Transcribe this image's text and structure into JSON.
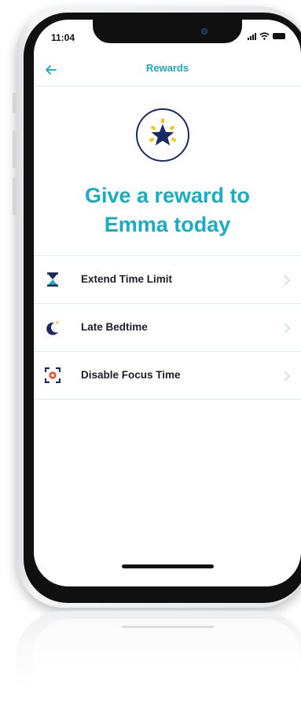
{
  "status_bar": {
    "time": "11:04"
  },
  "nav": {
    "back_icon": "arrow-left-icon",
    "title": "Rewards"
  },
  "hero": {
    "icon": "star-badge-icon",
    "headline_line1": "Give a reward to",
    "headline_line2": "Emma today"
  },
  "rewards": [
    {
      "label": "Extend Time Limit",
      "icon": "hourglass-icon"
    },
    {
      "label": "Late Bedtime",
      "icon": "moon-icon"
    },
    {
      "label": "Disable Focus Time",
      "icon": "focus-icon"
    }
  ],
  "colors": {
    "accent": "#19adc4",
    "navy": "#1b2a63",
    "star_yellow": "#f5c518",
    "focus_orange": "#e8542c",
    "divider": "#e1eef1"
  }
}
